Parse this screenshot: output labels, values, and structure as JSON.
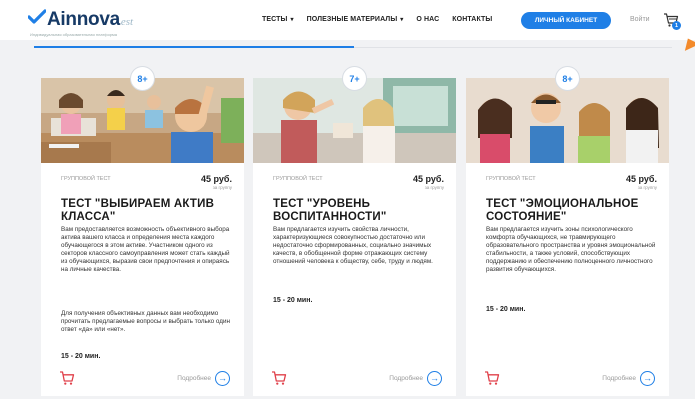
{
  "brand": {
    "name": "Ainnova",
    "suffix": "est",
    "tagline": "Индивидуальная образовательная платформа"
  },
  "nav": {
    "items": [
      {
        "label": "ТЕСТЫ",
        "dropdown": true
      },
      {
        "label": "ПОЛЕЗНЫЕ МАТЕРИАЛЫ",
        "dropdown": true
      },
      {
        "label": "О НАС",
        "dropdown": false
      },
      {
        "label": "КОНТАКТЫ",
        "dropdown": false
      }
    ],
    "cabinet_label": "ЛИЧНЫЙ КАБИНЕТ",
    "login_label": "Войти",
    "cart_count": "1",
    "caret": "▾"
  },
  "colors": {
    "accent": "#1f7fe6",
    "marker": "#f38a2b",
    "cart_icon": "#e0404a"
  },
  "cards": [
    {
      "age": "8+",
      "type": "ГРУППОВОЙ ТЕСТ",
      "price": "45 руб.",
      "price_unit": "за группу",
      "title": "ТЕСТ \"ВЫБИРАЕМ АКТИВ КЛАССА\"",
      "desc1": "Вам предоставляется возможность объективного выбора актива вашего класса и определения места каждого обучающегося в этом активе. Участником одного из секторов классного самоуправления может стать каждый из обучающихся, выразив свои предпочтения и опираясь на личные качества.",
      "desc2": "Для получения объективных данных вам необходимо прочитать предлагаемые вопросы и выбрать только один ответ «да» или «нет».",
      "duration": "15 - 20 мин.",
      "more_label": "Подробнее"
    },
    {
      "age": "7+",
      "type": "ГРУППОВОЙ ТЕСТ",
      "price": "45 руб.",
      "price_unit": "за группу",
      "title": "ТЕСТ \"УРОВЕНЬ ВОСПИТАННОСТИ\"",
      "desc1": "Вам предлагается изучить свойства личности, характеризующиеся совокупностью достаточно или недостаточно сформированных, социально значимых качеств, в обобщенной форме отражающих систему отношений человека к обществу, себе, труду и людям.",
      "desc2": "",
      "duration": "15 - 20 мин.",
      "more_label": "Подробнее"
    },
    {
      "age": "8+",
      "type": "ГРУППОВОЙ ТЕСТ",
      "price": "45 руб.",
      "price_unit": "за группу",
      "title": "ТЕСТ \"ЭМОЦИОНАЛЬНОЕ СОСТОЯНИЕ\"",
      "desc1": "Вам предлагается изучить зоны психологического комфорта обучающихся, не травмирующего образовательного пространства и уровня эмоциональной стабильности, а также условий, способствующих поддержанию и обеспечению полноценного личностного развития обучающихся.",
      "desc2": "",
      "duration": "15 - 20 мин.",
      "more_label": "Подробнее"
    }
  ]
}
